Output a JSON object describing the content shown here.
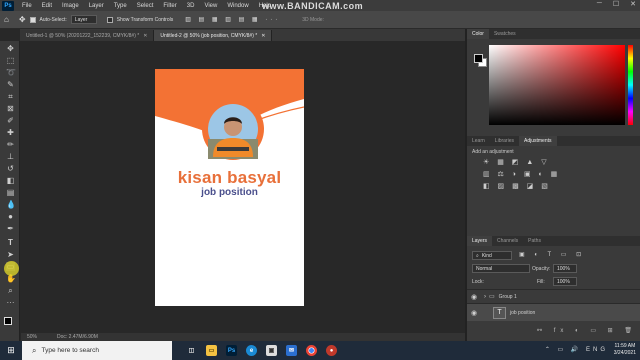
{
  "watermark": "www.BANDICAM.com",
  "menu": [
    "File",
    "Edit",
    "Image",
    "Layer",
    "Type",
    "Select",
    "Filter",
    "3D",
    "View",
    "Window",
    "Help"
  ],
  "app_logo": "Ps",
  "options": {
    "auto_select_label": "Auto-Select:",
    "auto_select_value": "Layer",
    "transform_controls_label": "Show Transform Controls",
    "mode_3d_label": "3D Mode:"
  },
  "tabs": [
    {
      "label": "Untitled-1 @ 50% (20201222_152239, CMYK/8#) *",
      "active": false
    },
    {
      "label": "Untitled-2 @ 50% (job position, CMYK/8#) *",
      "active": true
    }
  ],
  "card": {
    "name": "kisan basyal",
    "position": "job position",
    "accent_color": "#f37234",
    "name_color": "#e8703a",
    "position_color": "#4a4f8c"
  },
  "status": {
    "zoom": "50%",
    "doc": "Doc: 2.47M/6.90M"
  },
  "color_panel": {
    "tabs": [
      "Color",
      "Swatches"
    ]
  },
  "adjust_panel": {
    "tabs": [
      "Learn",
      "Libraries",
      "Adjustments"
    ],
    "hint": "Add an adjustment"
  },
  "layers_panel": {
    "tabs": [
      "Layers",
      "Channels",
      "Paths"
    ],
    "kind_label": "Kind",
    "blend_mode": "Normal",
    "opacity_label": "Opacity:",
    "opacity_value": "100%",
    "lock_label": "Lock:",
    "fill_label": "Fill:",
    "fill_value": "100%",
    "layers": [
      {
        "name": "Group 1",
        "type": "group"
      },
      {
        "name": "job position",
        "type": "text"
      }
    ]
  },
  "taskbar": {
    "search_placeholder": "Type here to search",
    "time": "11:59 AM",
    "date": "3/24/2021"
  }
}
